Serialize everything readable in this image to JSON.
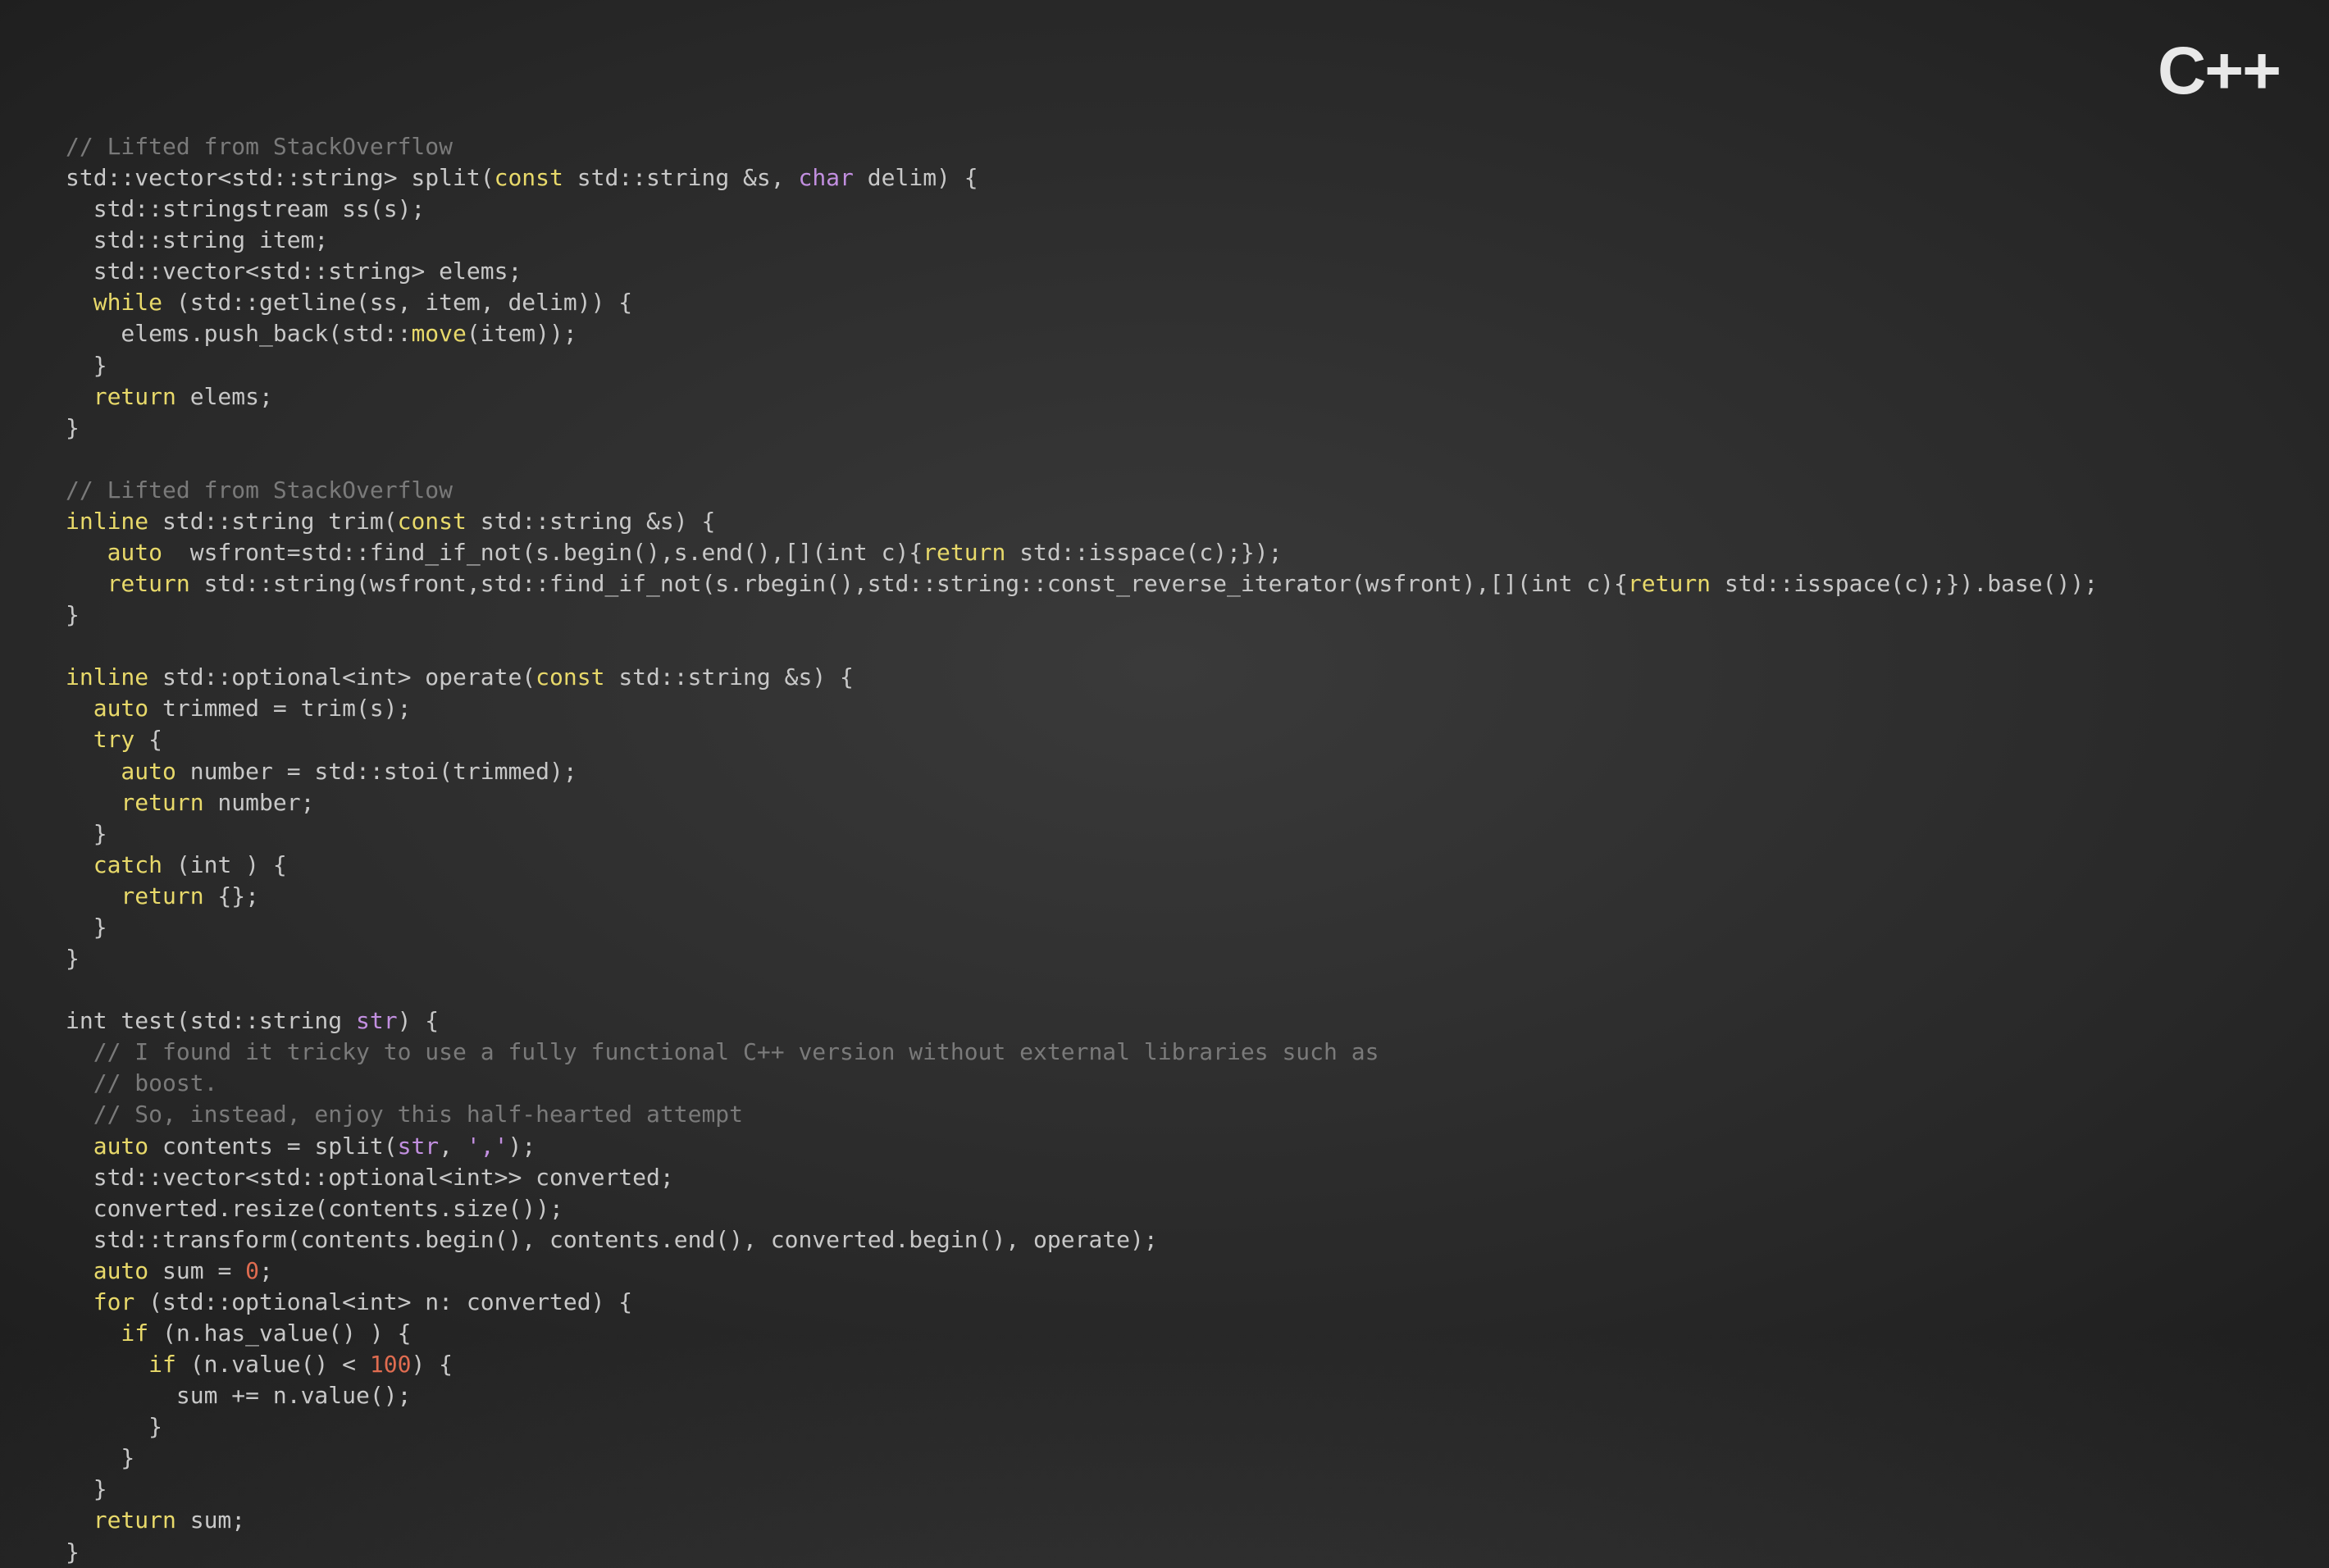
{
  "title": "C++",
  "code": {
    "c01": "// Lifted from StackOverflow",
    "c02a": "std::vector<std::string> split(",
    "c02_const": "const",
    "c02b": " std::string &s, ",
    "c02_char": "char",
    "c02c": " delim) {",
    "c03": "  std::stringstream ss(s);",
    "c04": "  std::string item;",
    "c05": "  std::vector<std::string> elems;",
    "c06_while": "  while",
    "c06b": " (std::getline(ss, item, delim)) {",
    "c07a": "    elems.push_back(std::",
    "c07_move": "move",
    "c07b": "(item));",
    "c08": "  }",
    "c09_ret": "  return",
    "c09b": " elems;",
    "c10": "}",
    "blank1": "",
    "c11": "// Lifted from StackOverflow",
    "c12_inl": "inline",
    "c12a": " std::string trim(",
    "c12_const": "const",
    "c12b": " std::string &s) {",
    "c13_auto": "   auto",
    "c13a": "  wsfront=std::find_if_not(s.begin(),s.end(),[](int c){",
    "c13_ret": "return",
    "c13b": " std::isspace(c);});",
    "c14_ret": "   return",
    "c14a": " std::string(wsfront,std::find_if_not(s.rbegin(),std::string::const_reverse_iterator(wsfront),[](int c){",
    "c14_ret2": "return",
    "c14b": " std::isspace(c);}).base());",
    "c15": "}",
    "blank2": "",
    "c16_inl": "inline",
    "c16a": " std::optional<int> operate(",
    "c16_const": "const",
    "c16b": " std::string &s) {",
    "c17_auto": "  auto",
    "c17a": " trimmed = trim(s);",
    "c18_try": "  try",
    "c18a": " {",
    "c19_auto": "    auto",
    "c19a": " number = std::stoi(trimmed);",
    "c20_ret": "    return",
    "c20a": " number;",
    "c21": "  }",
    "c22_catch": "  catch",
    "c22a": " (int ) {",
    "c23_ret": "    return",
    "c23a": " {};",
    "c24": "  }",
    "c25": "}",
    "blank3": "",
    "c26a": "int test(std::string ",
    "c26_str": "str",
    "c26b": ") {",
    "c27": "  // I found it tricky to use a fully functional C++ version without external libraries such as",
    "c28": "  // boost.",
    "c29": "  // So, instead, enjoy this half-hearted attempt",
    "c30_auto": "  auto",
    "c30a": " contents = split(",
    "c30_str": "str",
    "c30b": ", ",
    "c30_lit": "','",
    "c30c": ");",
    "c31": "  std::vector<std::optional<int>> converted;",
    "c32": "  converted.resize(contents.size());",
    "c33": "  std::transform(contents.begin(), contents.end(), converted.begin(), operate);",
    "c34_auto": "  auto",
    "c34a": " sum = ",
    "c34_zero": "0",
    "c34b": ";",
    "c35_for": "  for",
    "c35a": " (std::optional<int> n: converted) {",
    "c36_if": "    if",
    "c36a": " (n.has_value() ) {",
    "c37_if": "      if",
    "c37a": " (n.value() < ",
    "c37_hund": "100",
    "c37b": ") {",
    "c38": "        sum += n.value();",
    "c39": "      }",
    "c40": "    }",
    "c41": "  }",
    "c42_ret": "  return",
    "c42a": " sum;",
    "c43": "}"
  }
}
